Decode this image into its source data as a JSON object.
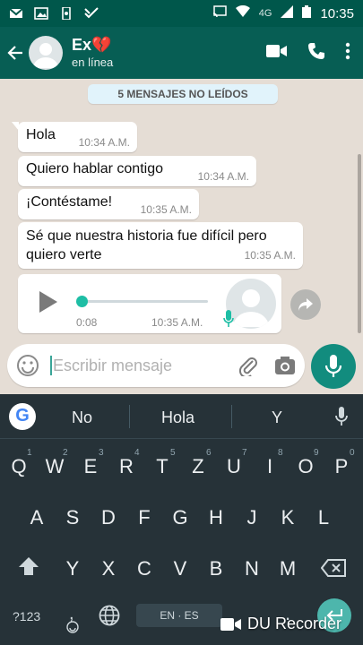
{
  "status_bar": {
    "network": "4G",
    "time": "10:35"
  },
  "header": {
    "contact_name": "Ex💔",
    "status": "en línea"
  },
  "chat": {
    "unread_banner": "5 MENSAJES NO LEÍDOS",
    "messages": [
      {
        "text": "Hola",
        "time": "10:34 A.M."
      },
      {
        "text": "Quiero hablar contigo",
        "time": "10:34 A.M."
      },
      {
        "text": "¡Contéstame!",
        "time": "10:35 A.M."
      },
      {
        "text_line1": "Sé que nuestra historia fue difícil pero",
        "text_line2": "quiero verte",
        "time": "10:35 A.M."
      }
    ],
    "voice_note": {
      "duration": "0:08",
      "time": "10:35 A.M.",
      "progress": 0
    }
  },
  "composer": {
    "placeholder": "Escribir mensaje"
  },
  "keyboard": {
    "suggestions": [
      "No",
      "Hola",
      "Y"
    ],
    "row1": [
      "Q",
      "W",
      "E",
      "R",
      "T",
      "Z",
      "U",
      "I",
      "O",
      "P"
    ],
    "row1_hints": [
      "1",
      "2",
      "3",
      "4",
      "5",
      "6",
      "7",
      "8",
      "9",
      "0"
    ],
    "row2": [
      "A",
      "S",
      "D",
      "F",
      "G",
      "H",
      "J",
      "K",
      "L"
    ],
    "row3": [
      "Y",
      "X",
      "C",
      "V",
      "B",
      "N",
      "M"
    ],
    "symbols_key": "?123",
    "comma_key": ",",
    "space_label": "EN · ES",
    "period_key": "."
  },
  "overlay": {
    "watermark": "DU Recorder"
  },
  "colors": {
    "header": "#075e54",
    "status_bar": "#00574b",
    "accent": "#128c7e",
    "keyboard": "#263238"
  }
}
